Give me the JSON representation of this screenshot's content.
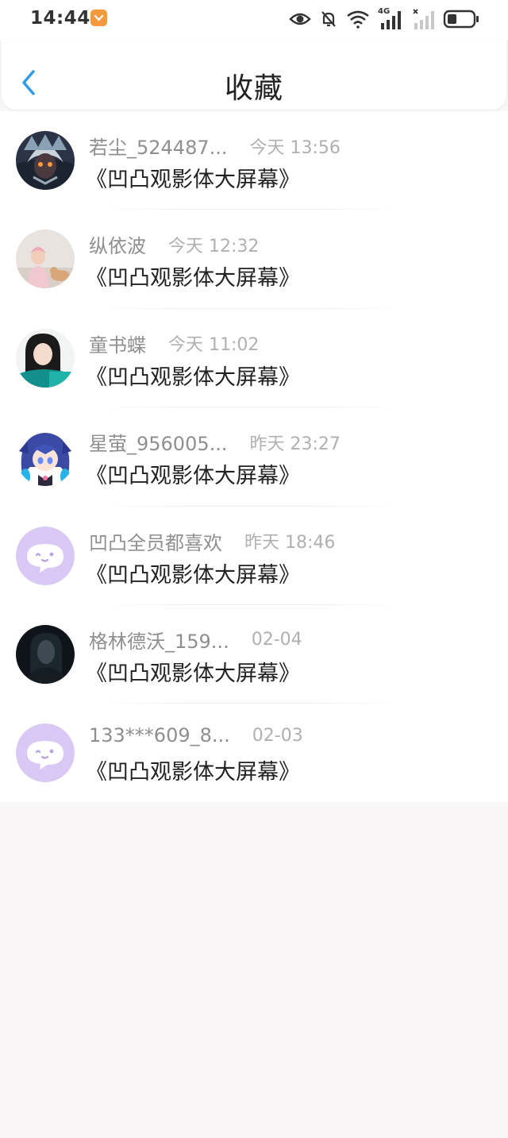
{
  "status_bar": {
    "time": "14:44",
    "network_label": "4G"
  },
  "header": {
    "title": "收藏"
  },
  "items": [
    {
      "username": "若尘_524487...",
      "time": "今天 13:56",
      "content": "《凹凸观影体大屏幕》",
      "avatar": "anime-mech"
    },
    {
      "username": "纵依波",
      "time": "今天 12:32",
      "content": "《凹凸观影体大屏幕》",
      "avatar": "girl-photo"
    },
    {
      "username": "童书蝶",
      "time": "今天 11:02",
      "content": "《凹凸观影体大屏幕》",
      "avatar": "girl-teal"
    },
    {
      "username": "星萤_956005...",
      "time": "昨天 23:27",
      "content": "《凹凸观影体大屏幕》",
      "avatar": "anime-girl"
    },
    {
      "username": "凹凸全员都喜欢",
      "time": "昨天 18:46",
      "content": "《凹凸观影体大屏幕》",
      "avatar": "default-chat"
    },
    {
      "username": "格林德沃_159...",
      "time": "02-04",
      "content": "《凹凸观影体大屏幕》",
      "avatar": "dark-portrait"
    },
    {
      "username": "133***609_8...",
      "time": "02-03",
      "content": "《凹凸观影体大屏幕》",
      "avatar": "default-chat"
    }
  ],
  "colors": {
    "accent": "#2f9ae8",
    "default_avatar": "#d9c8f3"
  }
}
